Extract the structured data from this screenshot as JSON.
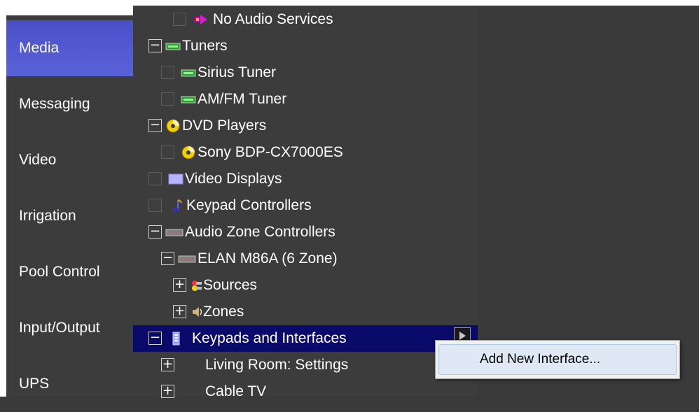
{
  "sidebar": {
    "items": [
      {
        "label": "Media",
        "active": true
      },
      {
        "label": "Messaging"
      },
      {
        "label": "Video"
      },
      {
        "label": "Irrigation"
      },
      {
        "label": "Pool Control"
      },
      {
        "label": "Input/Output"
      },
      {
        "label": "UPS"
      }
    ]
  },
  "tree": {
    "rows": [
      {
        "label": "No Audio Services",
        "icon": "arrow-icon",
        "control": "checkbox",
        "indent": 2
      },
      {
        "label": "Tuners",
        "icon": "tuner-icon",
        "control": "collapse",
        "indent": 1
      },
      {
        "label": "Sirius Tuner",
        "icon": "tuner-icon",
        "control": "checkbox",
        "indent": 2
      },
      {
        "label": "AM/FM Tuner",
        "icon": "tuner-icon",
        "control": "checkbox",
        "indent": 2
      },
      {
        "label": "DVD Players",
        "icon": "disc-icon",
        "control": "collapse",
        "indent": 1
      },
      {
        "label": "Sony BDP-CX7000ES",
        "icon": "disc-icon",
        "control": "checkbox",
        "indent": 2
      },
      {
        "label": "Video Displays",
        "icon": "display-icon",
        "control": "checkbox",
        "indent": 1
      },
      {
        "label": "Keypad Controllers",
        "icon": "music-note-icon",
        "control": "checkbox",
        "indent": 1
      },
      {
        "label": "Audio Zone Controllers",
        "icon": "zone-controller-icon",
        "control": "collapse",
        "indent": 1
      },
      {
        "label": "ELAN M86A (6 Zone)",
        "icon": "zone-controller-icon",
        "control": "collapse",
        "indent": 2
      },
      {
        "label": "Sources",
        "icon": "cables-icon",
        "control": "expand",
        "indent": 3
      },
      {
        "label": "Zones",
        "icon": "speaker-icon",
        "control": "expand",
        "indent": 3
      },
      {
        "label": "Keypads and Interfaces",
        "icon": "keypad-icon",
        "control": "collapse",
        "indent": 1,
        "selected": true
      },
      {
        "label": "Living Room: Settings",
        "icon": "",
        "control": "expand",
        "indent": 2
      },
      {
        "label": "Cable TV",
        "icon": "",
        "control": "expand",
        "indent": 2
      }
    ]
  },
  "context_menu": {
    "items": [
      {
        "label": "Add New Interface..."
      }
    ]
  },
  "colors": {
    "sidebar_active": "#4f55cc",
    "selected_row": "#0a0a6a",
    "panel_bg": "#3c3c3c",
    "menu_hover": "#dfe9f6"
  }
}
